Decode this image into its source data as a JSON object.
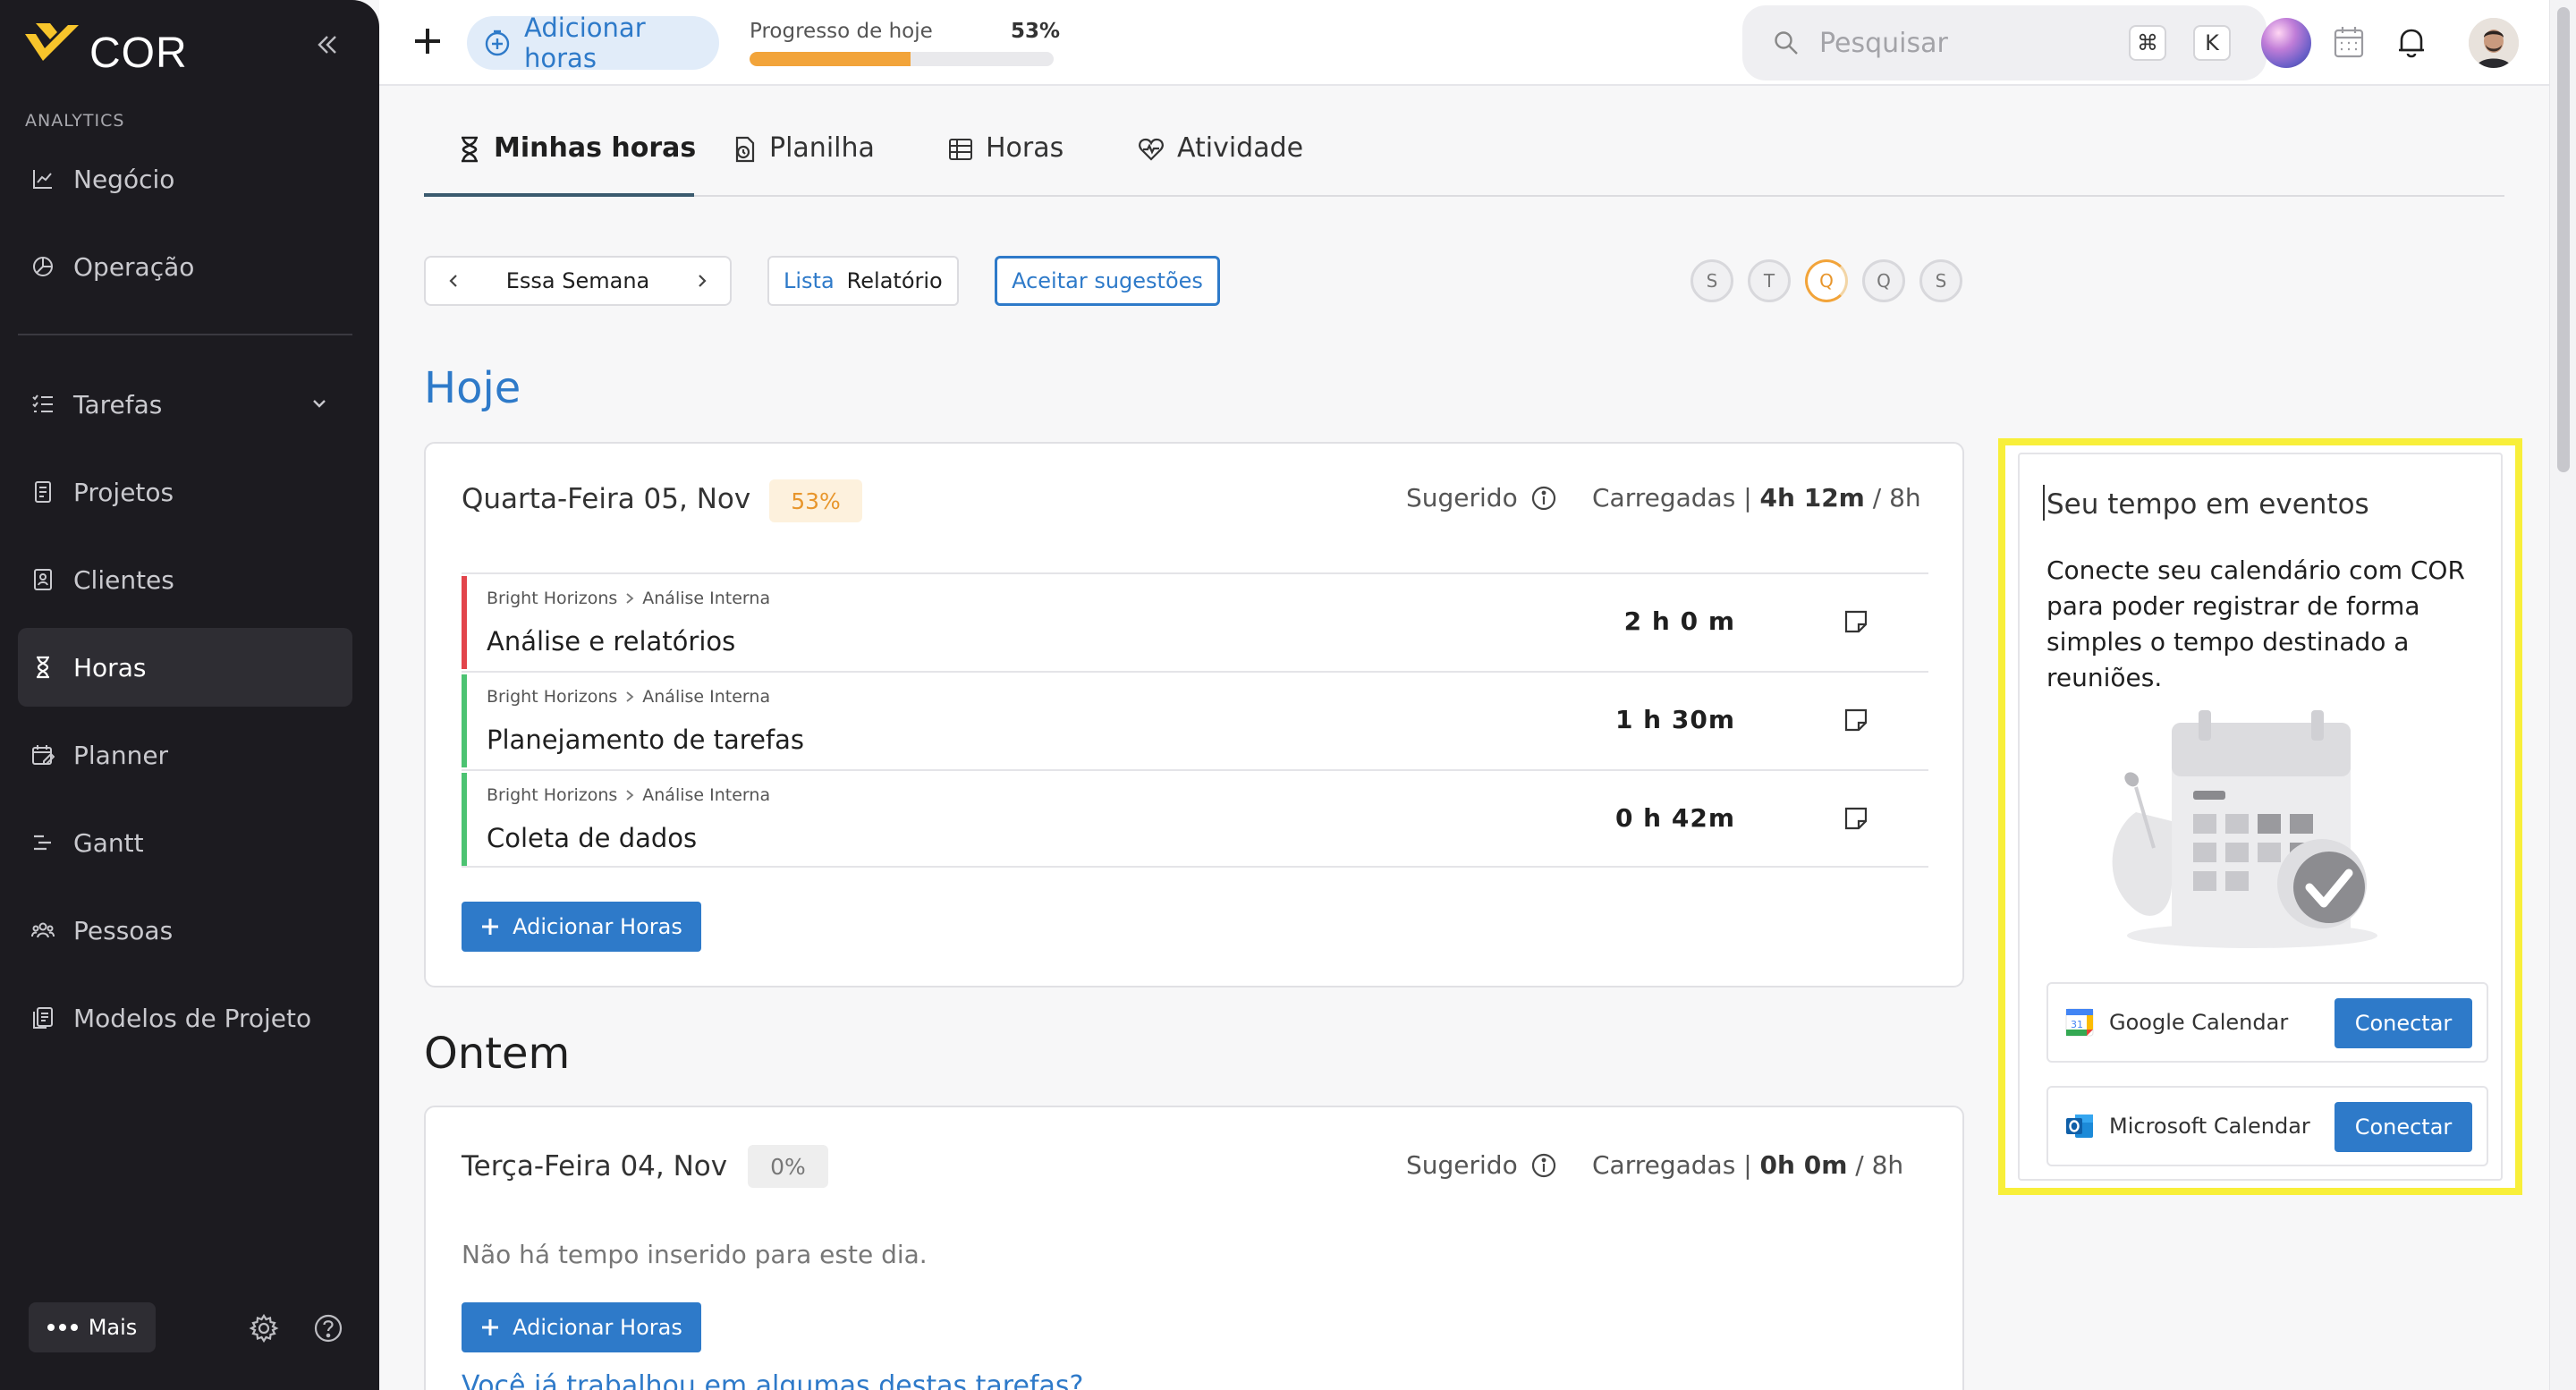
{
  "app": {
    "brand": "COR"
  },
  "sidebar": {
    "section_label": "ANALYTICS",
    "items": [
      {
        "label": "Negócio",
        "icon": "chart-line-icon"
      },
      {
        "label": "Operação",
        "icon": "pie-chart-icon"
      },
      {
        "label": "Tarefas",
        "icon": "checklist-icon"
      },
      {
        "label": "Projetos",
        "icon": "document-icon"
      },
      {
        "label": "Clientes",
        "icon": "contact-book-icon"
      },
      {
        "label": "Horas",
        "icon": "hourglass-icon",
        "active": true
      },
      {
        "label": "Planner",
        "icon": "calendar-edit-icon"
      },
      {
        "label": "Gantt",
        "icon": "gantt-icon"
      },
      {
        "label": "Pessoas",
        "icon": "people-icon"
      },
      {
        "label": "Modelos de Projeto",
        "icon": "template-icon"
      }
    ],
    "more_label": "Mais"
  },
  "topbar": {
    "add_hours_label": "Adicionar horas",
    "progress_label": "Progresso de hoje",
    "progress_pct_text": "53%",
    "progress_value": 0.53,
    "search_placeholder": "Pesquisar",
    "shortcut_keys": [
      "⌘",
      "K"
    ]
  },
  "tabs": [
    {
      "label": "Minhas horas",
      "icon": "hourglass-icon",
      "active": true
    },
    {
      "label": "Planilha",
      "icon": "timesheet-icon"
    },
    {
      "label": "Horas",
      "icon": "table-icon"
    },
    {
      "label": "Atividade",
      "icon": "heart-pulse-icon"
    }
  ],
  "filters": {
    "week_label": "Essa Semana",
    "view_option_a": "Lista",
    "view_option_b": "Relatório",
    "accept_label": "Aceitar sugestões",
    "days": [
      "S",
      "T",
      "Q",
      "Q",
      "S"
    ],
    "today_index": 2
  },
  "today": {
    "heading": "Hoje",
    "date": "Quarta-Feira 05, Nov",
    "badge": "53%",
    "suggested_label": "Sugerido",
    "loaded_label": "Carregadas |",
    "loaded_value": "4h 12m",
    "loaded_target": "/  8h",
    "entries": [
      {
        "client": "Bright Horizons",
        "project": "Análise Interna",
        "task": "Análise e relatórios",
        "duration": "2 h   0 m",
        "color": "#e2444b"
      },
      {
        "client": "Bright Horizons",
        "project": "Análise Interna",
        "task": "Planejamento de tarefas",
        "duration": "1 h  30m",
        "color": "#4cc372"
      },
      {
        "client": "Bright Horizons",
        "project": "Análise Interna",
        "task": "Coleta de dados",
        "duration": "0 h  42m",
        "color": "#4cc372"
      }
    ],
    "add_label": "Adicionar Horas"
  },
  "yesterday": {
    "heading": "Ontem",
    "date": "Terça-Feira 04, Nov",
    "badge": "0%",
    "suggested_label": "Sugerido",
    "loaded_label": "Carregadas |",
    "loaded_value": "0h 0m",
    "loaded_target": "/  8h",
    "empty_message": "Não há tempo inserido para este dia.",
    "add_label": "Adicionar Horas",
    "link_text": "Você já trabalhou em algumas destas tarefas?"
  },
  "events_panel": {
    "title": "Seu tempo em eventos",
    "description": "Conecte seu calendário com COR para poder registrar de forma simples o tempo destinado a reuniões.",
    "calendars": [
      {
        "name": "Google Calendar",
        "button": "Conectar",
        "icon": "google-calendar-icon"
      },
      {
        "name": "Microsoft Calendar",
        "button": "Conectar",
        "icon": "outlook-icon"
      }
    ]
  },
  "colors": {
    "accent": "#2e7ac9",
    "progress": "#f2a43a",
    "sidebar_bg": "#1c1b20",
    "highlight": "#f8ef3a"
  }
}
